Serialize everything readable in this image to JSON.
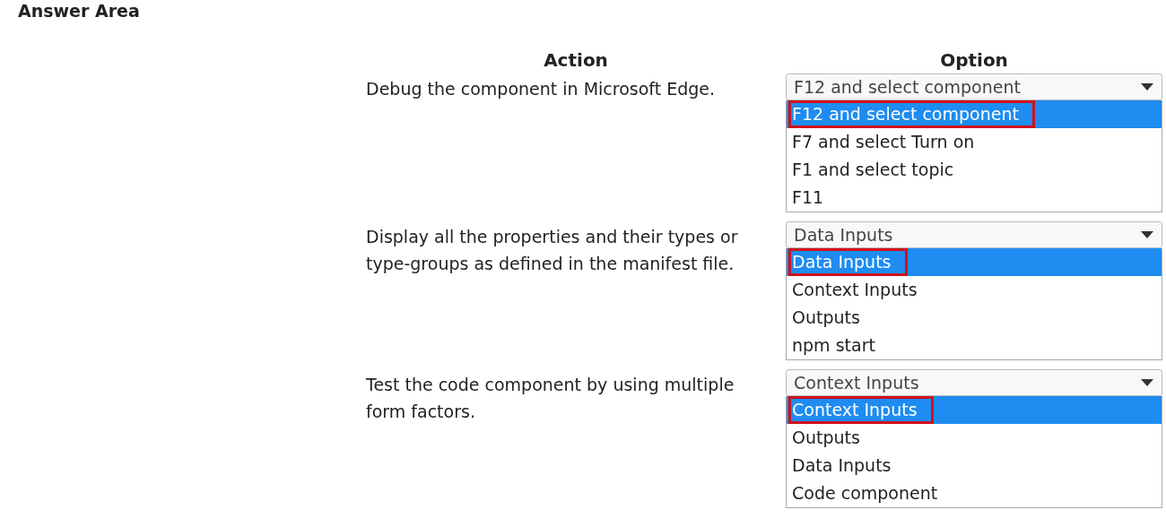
{
  "title": "Answer Area",
  "columns": [
    "Action",
    "Option"
  ],
  "rows": [
    {
      "action": "Debug the component in Microsoft Edge.",
      "dropdown": {
        "value": "F12 and select component",
        "options": [
          {
            "label": "F12 and select component",
            "selected": true
          },
          {
            "label": "F7 and select Turn on",
            "selected": false
          },
          {
            "label": "F1 and select topic",
            "selected": false
          },
          {
            "label": "F11",
            "selected": false
          }
        ]
      }
    },
    {
      "action": "Display all the properties and their types or type-groups as defined in the manifest file.",
      "dropdown": {
        "value": "Data Inputs",
        "options": [
          {
            "label": "Data Inputs",
            "selected": true
          },
          {
            "label": "Context Inputs",
            "selected": false
          },
          {
            "label": "Outputs",
            "selected": false
          },
          {
            "label": "npm start",
            "selected": false
          }
        ]
      }
    },
    {
      "action": "Test the code component by using multiple form factors.",
      "dropdown": {
        "value": "Context Inputs",
        "options": [
          {
            "label": "Context Inputs",
            "selected": true
          },
          {
            "label": "Outputs",
            "selected": false
          },
          {
            "label": "Data Inputs",
            "selected": false
          },
          {
            "label": "Code component",
            "selected": false
          }
        ]
      }
    }
  ]
}
